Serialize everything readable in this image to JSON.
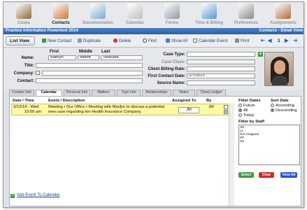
{
  "nav": [
    {
      "label": "Cases",
      "icon": "briefcase-icon",
      "color": "#8a6a3a"
    },
    {
      "label": "Contacts",
      "icon": "people-icon",
      "color": "#c9773a"
    },
    {
      "label": "Documentation",
      "icon": "documents-icon",
      "color": "#7fa9c9"
    },
    {
      "label": "Calendar",
      "icon": "calendar-icon",
      "color": "#bfbfbf"
    },
    {
      "label": "Forms",
      "icon": "pen-icon",
      "color": "#8f9aa8"
    },
    {
      "label": "Time & Billing",
      "icon": "stopwatch-icon",
      "color": "#5b95d1"
    },
    {
      "label": "Preferences",
      "icon": "gear-icon",
      "color": "#8b8b8b"
    },
    {
      "label": "Assignments",
      "icon": "tools-icon",
      "color": "#b06a3a"
    }
  ],
  "title": {
    "left": "Practice Information Powertool 2014",
    "right": "Contacts - Detail View"
  },
  "toolbar": {
    "list_view": "List View",
    "new_contact": "New Contact",
    "duplicate": "Duplicate",
    "delete": "Delete",
    "find": "Find",
    "show_all": "Show All",
    "calendar_event": "Calendar Event",
    "print": "Print",
    "page": "1"
  },
  "form": {
    "name_label": "Name:",
    "first_header": "First",
    "middle_header": "Middle",
    "last_header": "Last",
    "first": "Marilyn",
    "middle": "Midrift",
    "last": "Testcase",
    "title_label": "Title:",
    "company_label": "Company:",
    "contact_label": "Contact:",
    "case_type_label": "Case Type:",
    "case_class_label": "Case Class:",
    "billing_rate_label": "Client Billing Rate:",
    "first_contact_label": "First Contact Date:",
    "first_contact_date": "1/7/2013",
    "source_label": "Source Name:"
  },
  "tabs": [
    "Contact Info",
    "Calendar",
    "Personal Info",
    "Matters",
    "Type Info",
    "Relationships",
    "Notes",
    "Client Ledger"
  ],
  "active_tab": 1,
  "grid": {
    "headers": [
      "Date / Time",
      "Event / Description",
      "Assigned To",
      "By"
    ],
    "rows": [
      {
        "date": "3/12/14 - Wed",
        "time": "10:00 am",
        "event": "Meeting • Our Office • Meeting with Marilyn to discuss a potential new case regarding her Health Insurance Company.",
        "assigned": "JM",
        "by": "JM"
      }
    ]
  },
  "filters": {
    "dates_label": "Filter Dates",
    "dates_options": [
      "Future",
      "All",
      "Today"
    ],
    "dates_selected": 1,
    "sort_label": "Sort Date",
    "sort_options": [
      "Ascending",
      "Descending"
    ],
    "sort_selected": 1,
    "staff_label": "Filter by Staff",
    "staff": [
      "JM",
      "LL",
      "Not Assigned",
      "PP",
      "SS"
    ],
    "select_all": "Select All",
    "clear": "Clear",
    "view_all": "View All"
  },
  "add_event": "Add Event To Calendar",
  "colors": {
    "select_all": "#3f9a3f",
    "clear": "#d02828",
    "view_all": "#2a52c9"
  }
}
